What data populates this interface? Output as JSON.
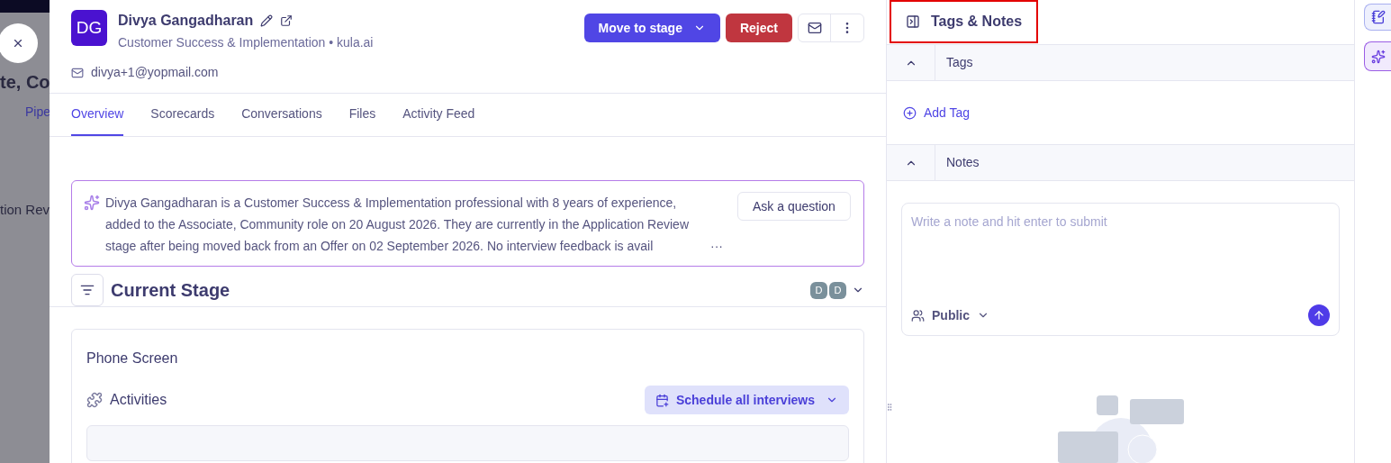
{
  "backdrop": {
    "title": "te, Co",
    "tab": "Pipe",
    "stage": "tion Rev"
  },
  "candidate": {
    "initials": "DG",
    "name": "Divya Gangadharan",
    "subtitle": "Customer Success & Implementation • kula.ai",
    "email": "divya+1@yopmail.com"
  },
  "actions": {
    "move": "Move to stage",
    "reject": "Reject"
  },
  "tabs": [
    {
      "label": "Overview",
      "selected": true
    },
    {
      "label": "Scorecards",
      "selected": false
    },
    {
      "label": "Conversations",
      "selected": false
    },
    {
      "label": "Files",
      "selected": false
    },
    {
      "label": "Activity Feed",
      "selected": false
    }
  ],
  "summary": {
    "text": "Divya Gangadharan is a Customer Success & Implementation professional with 8 years of experience, added to the Associate, Community role on 20 August 2026. They are currently in the Application Review stage after being moved back from an Offer on 02 September 2026. No interview feedback is avail",
    "more": "···",
    "ask": "Ask a question"
  },
  "current_stage": {
    "title": "Current Stage",
    "assignees": [
      "D",
      "D"
    ],
    "stage_name": "Phone Screen",
    "activities": "Activities",
    "schedule": "Schedule all interviews"
  },
  "side_panel": {
    "title": "Tags & Notes",
    "sections": [
      {
        "label": "Tags",
        "expanded": true
      },
      {
        "label": "Notes",
        "expanded": true
      }
    ],
    "add_tag": "Add Tag",
    "note": {
      "placeholder": "Write a note and hit enter to submit",
      "visibility": "Public"
    }
  }
}
